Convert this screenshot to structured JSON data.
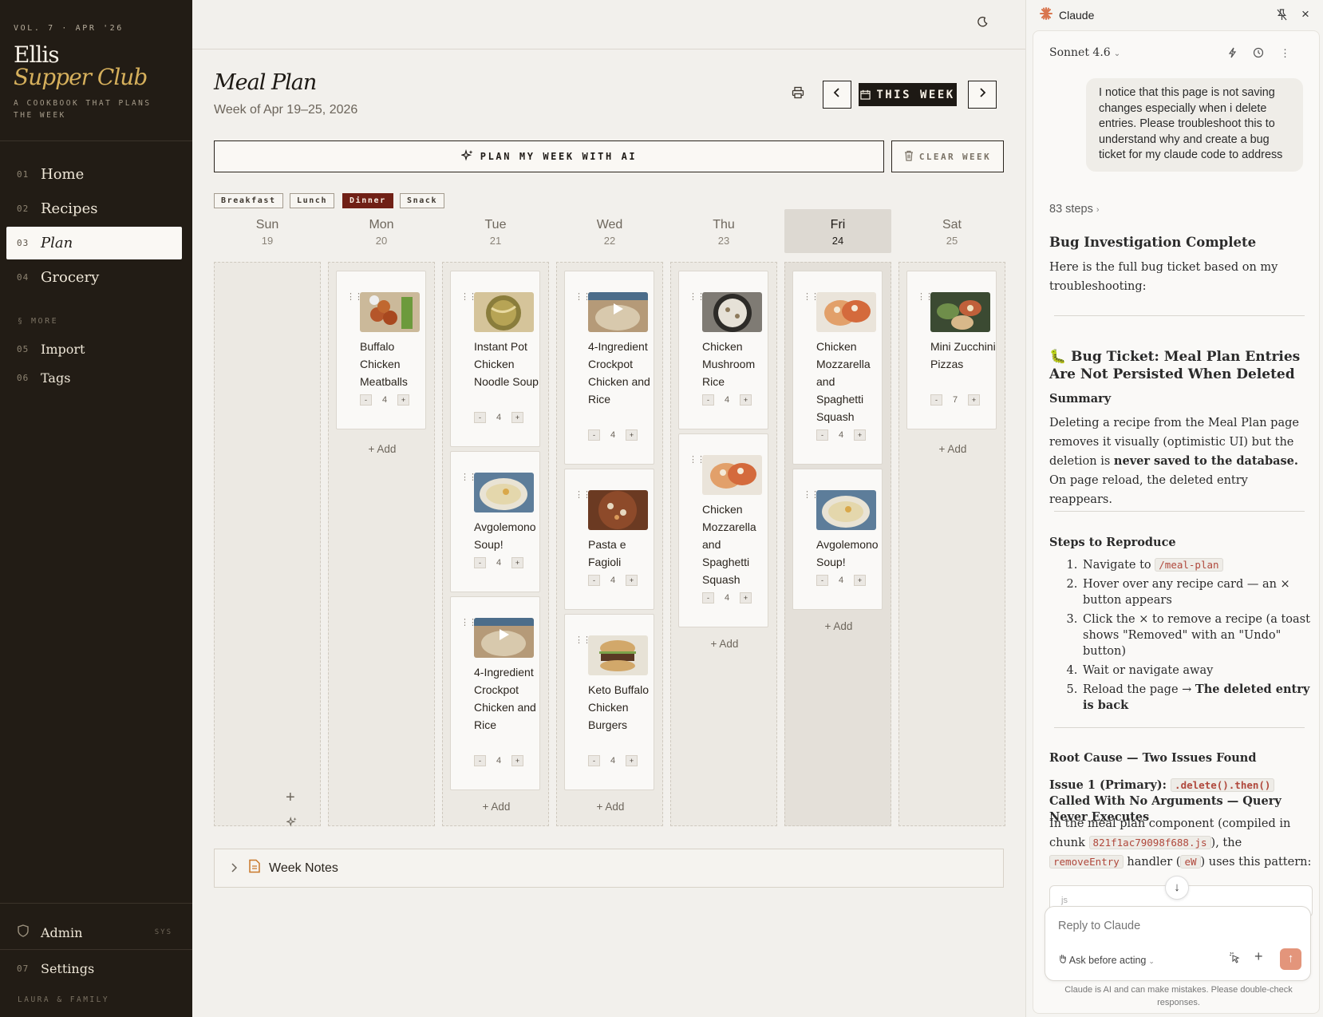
{
  "sidebar": {
    "volume": "VOL. 7 · APR '26",
    "brand_line1": "Ellis",
    "brand_line2": "Supper Club",
    "tagline": "A COOKBOOK THAT PLANS THE WEEK",
    "nav": [
      {
        "num": "01",
        "label": "Home"
      },
      {
        "num": "02",
        "label": "Recipes"
      },
      {
        "num": "03",
        "label": "Plan"
      },
      {
        "num": "04",
        "label": "Grocery"
      }
    ],
    "more_label": "§ MORE",
    "more_nav": [
      {
        "num": "05",
        "label": "Import"
      },
      {
        "num": "06",
        "label": "Tags"
      }
    ],
    "admin_label": "Admin",
    "admin_tag": "SYS",
    "settings": {
      "num": "07",
      "label": "Settings"
    },
    "family": "LAURA & FAMILY",
    "active_item": "Plan"
  },
  "main": {
    "title": "Meal Plan",
    "subtitle": "Week of Apr 19–25, 2026",
    "this_week_label": "THIS WEEK",
    "plan_ai_label": "PLAN MY WEEK WITH AI",
    "clear_week_label": "CLEAR WEEK",
    "meal_types": [
      "Breakfast",
      "Lunch",
      "Dinner",
      "Snack"
    ],
    "active_meal_type": "Dinner",
    "add_label": "+ Add",
    "week_notes_label": "Week Notes",
    "days": [
      {
        "name": "Sun",
        "date": "19",
        "meals": []
      },
      {
        "name": "Mon",
        "date": "20",
        "meals": [
          {
            "name": "Buffalo Chicken Meatballs",
            "servings": "4"
          }
        ]
      },
      {
        "name": "Tue",
        "date": "21",
        "meals": [
          {
            "name": "Instant Pot Chicken Noodle Soup",
            "servings": "4"
          },
          {
            "name": "Avgolemono Soup!",
            "servings": "4"
          },
          {
            "name": "4-Ingredient Crockpot Chicken and Rice",
            "servings": "4"
          }
        ]
      },
      {
        "name": "Wed",
        "date": "22",
        "meals": [
          {
            "name": "4-Ingredient Crockpot Chicken and Rice",
            "servings": "4"
          },
          {
            "name": "Pasta e Fagioli",
            "servings": "4"
          },
          {
            "name": "Keto Buffalo Chicken Burgers",
            "servings": "4"
          }
        ]
      },
      {
        "name": "Thu",
        "date": "23",
        "meals": [
          {
            "name": "Chicken Mushroom Rice",
            "servings": "4"
          },
          {
            "name": "Chicken Mozzarella and Spaghetti Squash",
            "servings": "4"
          }
        ]
      },
      {
        "name": "Fri",
        "date": "24",
        "today": true,
        "meals": [
          {
            "name": "Chicken Mozzarella and Spaghetti Squash",
            "servings": "4"
          },
          {
            "name": "Avgolemono Soup!",
            "servings": "4"
          }
        ]
      },
      {
        "name": "Sat",
        "date": "25",
        "meals": [
          {
            "name": "Mini Zucchini Pizzas",
            "servings": "7"
          }
        ]
      }
    ]
  },
  "claude": {
    "title": "Claude",
    "model": "Sonnet 4.6",
    "user_message": "I notice that this page is not saving changes especially when i delete entries.  Please troubleshoot this to understand why and create a bug ticket for my claude code to address",
    "steps": "83 steps",
    "h_complete": "Bug Investigation Complete",
    "intro": "Here is the full bug ticket based on my troubleshooting:",
    "ticket_title": "🐛 Bug Ticket: Meal Plan Entries Are Not Persisted When Deleted",
    "summary_h": "Summary",
    "summary_1": "Deleting a recipe from the Meal Plan page removes it visually (optimistic UI) but the deletion is ",
    "summary_bold": "never saved to the database.",
    "summary_2": " On page reload, the deleted entry reappears.",
    "repro_h": "Steps to Reproduce",
    "repro_1_pre": "Navigate to ",
    "repro_1_code": "/meal-plan",
    "repro_2": "Hover over any recipe card — an × button appears",
    "repro_3": "Click the × to remove a recipe (a toast shows \"Removed\" with an \"Undo\" button)",
    "repro_4": "Wait or navigate away",
    "repro_5_pre": "Reload the page → ",
    "repro_5_bold": "The deleted entry is back",
    "root_h": "Root Cause — Two Issues Found",
    "issue1_pre": "Issue 1 (Primary): ",
    "issue1_code": ".delete().then()",
    "issue1_post": " Called With No Arguments — Query Never Executes",
    "issue1_body_1": "In the meal plan component (compiled in chunk ",
    "issue1_code2": "821f1ac79098f688.js",
    "issue1_body_2": "), the ",
    "issue1_code3": "removeEntry",
    "issue1_body_3": " handler (",
    "issue1_code4": "eW",
    "issue1_body_4": ") uses this pattern:",
    "code_peek": "js",
    "reply_placeholder": "Reply to Claude",
    "ask_label": "Ask before acting",
    "disclaimer": "Claude is AI and can make mistakes. Please double-check responses."
  }
}
